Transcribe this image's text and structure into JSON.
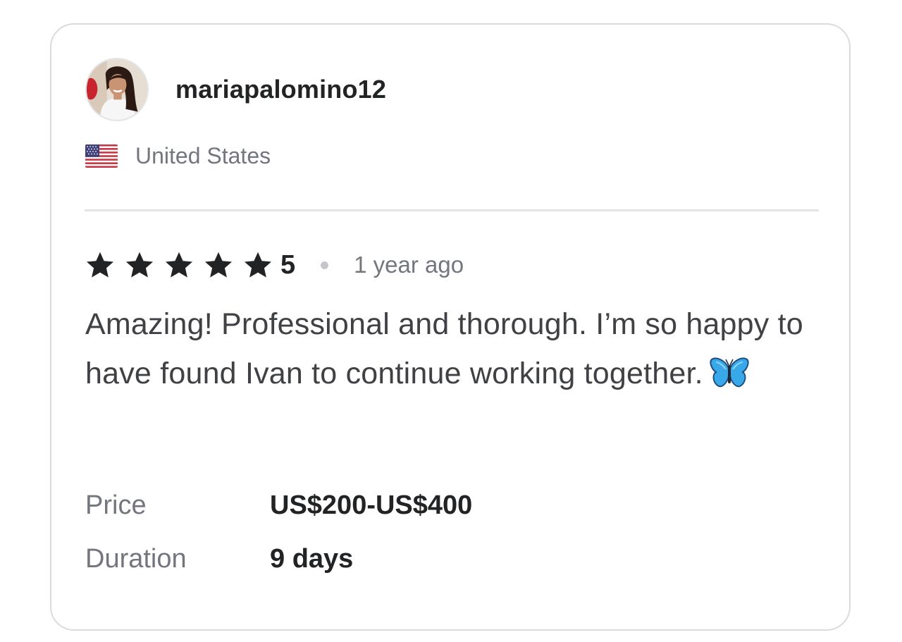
{
  "review": {
    "username": "mariapalomino12",
    "avatar_icon": "user-avatar-photo",
    "country": "United States",
    "flag_icon": "us-flag-icon",
    "rating": "5",
    "star_count": 5,
    "time_ago": "1 year ago",
    "text": "Amazing! Professional and thorough. I’m so happy to have found Ivan to continue working together.",
    "emoji_icon": "butterfly-emoji",
    "price_label": "Price",
    "price_value": "US$200-US$400",
    "duration_label": "Duration",
    "duration_value": "9 days"
  },
  "colors": {
    "star": "#222325",
    "primary_text": "#222325",
    "secondary_text": "#74767e",
    "body_text": "#404145",
    "border": "#dadbdd"
  }
}
